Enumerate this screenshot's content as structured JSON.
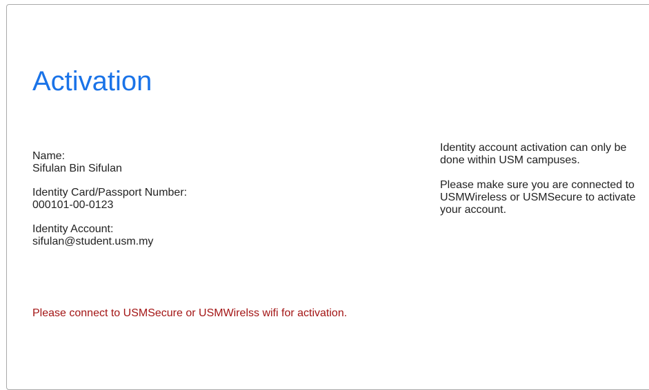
{
  "page": {
    "title": "Activation",
    "title_color": "#1a73e8"
  },
  "profile": {
    "name_label": "Name:",
    "name_value": "Sifulan Bin Sifulan",
    "id_label": "Identity Card/Passport Number:",
    "id_value": "000101-00-0123",
    "account_label": "Identity Account:",
    "account_value": "sifulan@student.usm.my"
  },
  "notice": {
    "line1": "Identity account activation can only be done within USM campuses.",
    "line2": "Please make sure you are connected to USMWireless or USMSecure to activate your account."
  },
  "error": {
    "message": "Please connect to USMSecure or USMWirelss wifi for activation.",
    "color": "#a31515"
  }
}
